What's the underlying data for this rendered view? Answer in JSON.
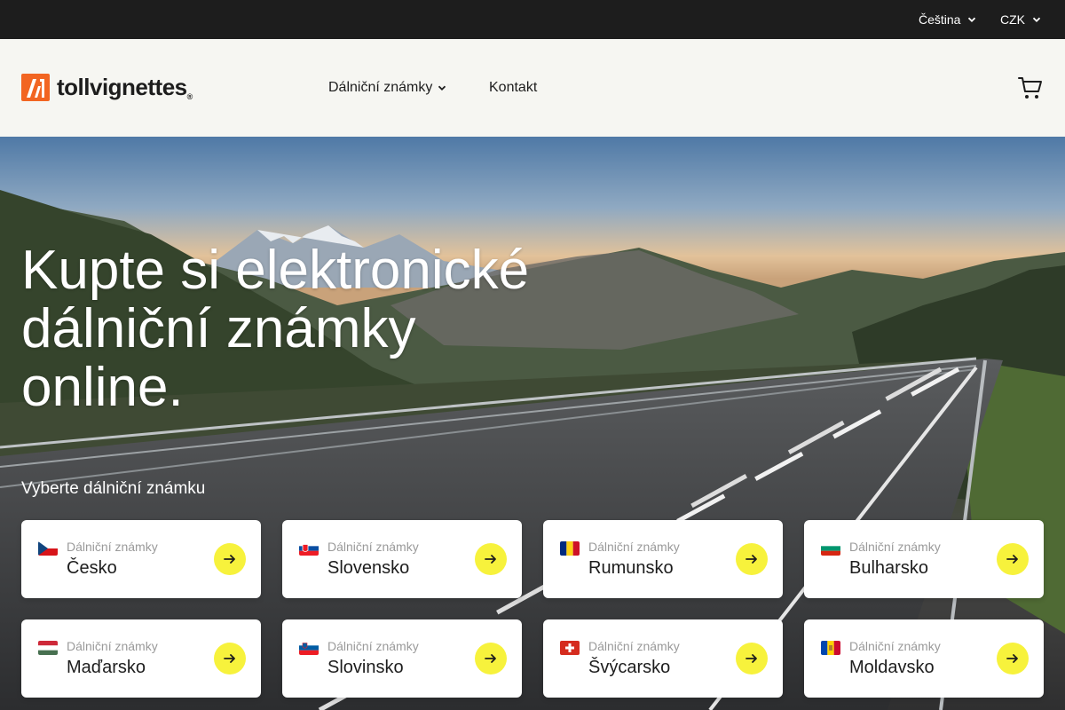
{
  "topbar": {
    "language": "Čeština",
    "currency": "CZK"
  },
  "header": {
    "logo_text": "tollvignettes",
    "nav": [
      {
        "label": "Dálniční známky",
        "has_dropdown": true
      },
      {
        "label": "Kontakt",
        "has_dropdown": false
      }
    ],
    "cart_icon": "cart-icon"
  },
  "hero": {
    "title": "Kupte si elektronické dálniční známky online.",
    "subtitle": "Vyberte dálniční známku"
  },
  "cards": [
    {
      "kicker": "Dálniční známky",
      "country": "Česko"
    },
    {
      "kicker": "Dálniční známky",
      "country": "Slovensko"
    },
    {
      "kicker": "Dálniční známky",
      "country": "Rumunsko"
    },
    {
      "kicker": "Dálniční známky",
      "country": "Bulharsko"
    },
    {
      "kicker": "Dálniční známky",
      "country": "Maďarsko"
    },
    {
      "kicker": "Dálniční známky",
      "country": "Slovinsko"
    },
    {
      "kicker": "Dálniční známky",
      "country": "Švýcarsko"
    },
    {
      "kicker": "Dálniční známky",
      "country": "Moldavsko"
    }
  ],
  "colors": {
    "topbar_bg": "#1d1d1d",
    "header_bg": "#f6f6f2",
    "brand_orange": "#f26522",
    "arrow_button": "#f7f23c"
  }
}
